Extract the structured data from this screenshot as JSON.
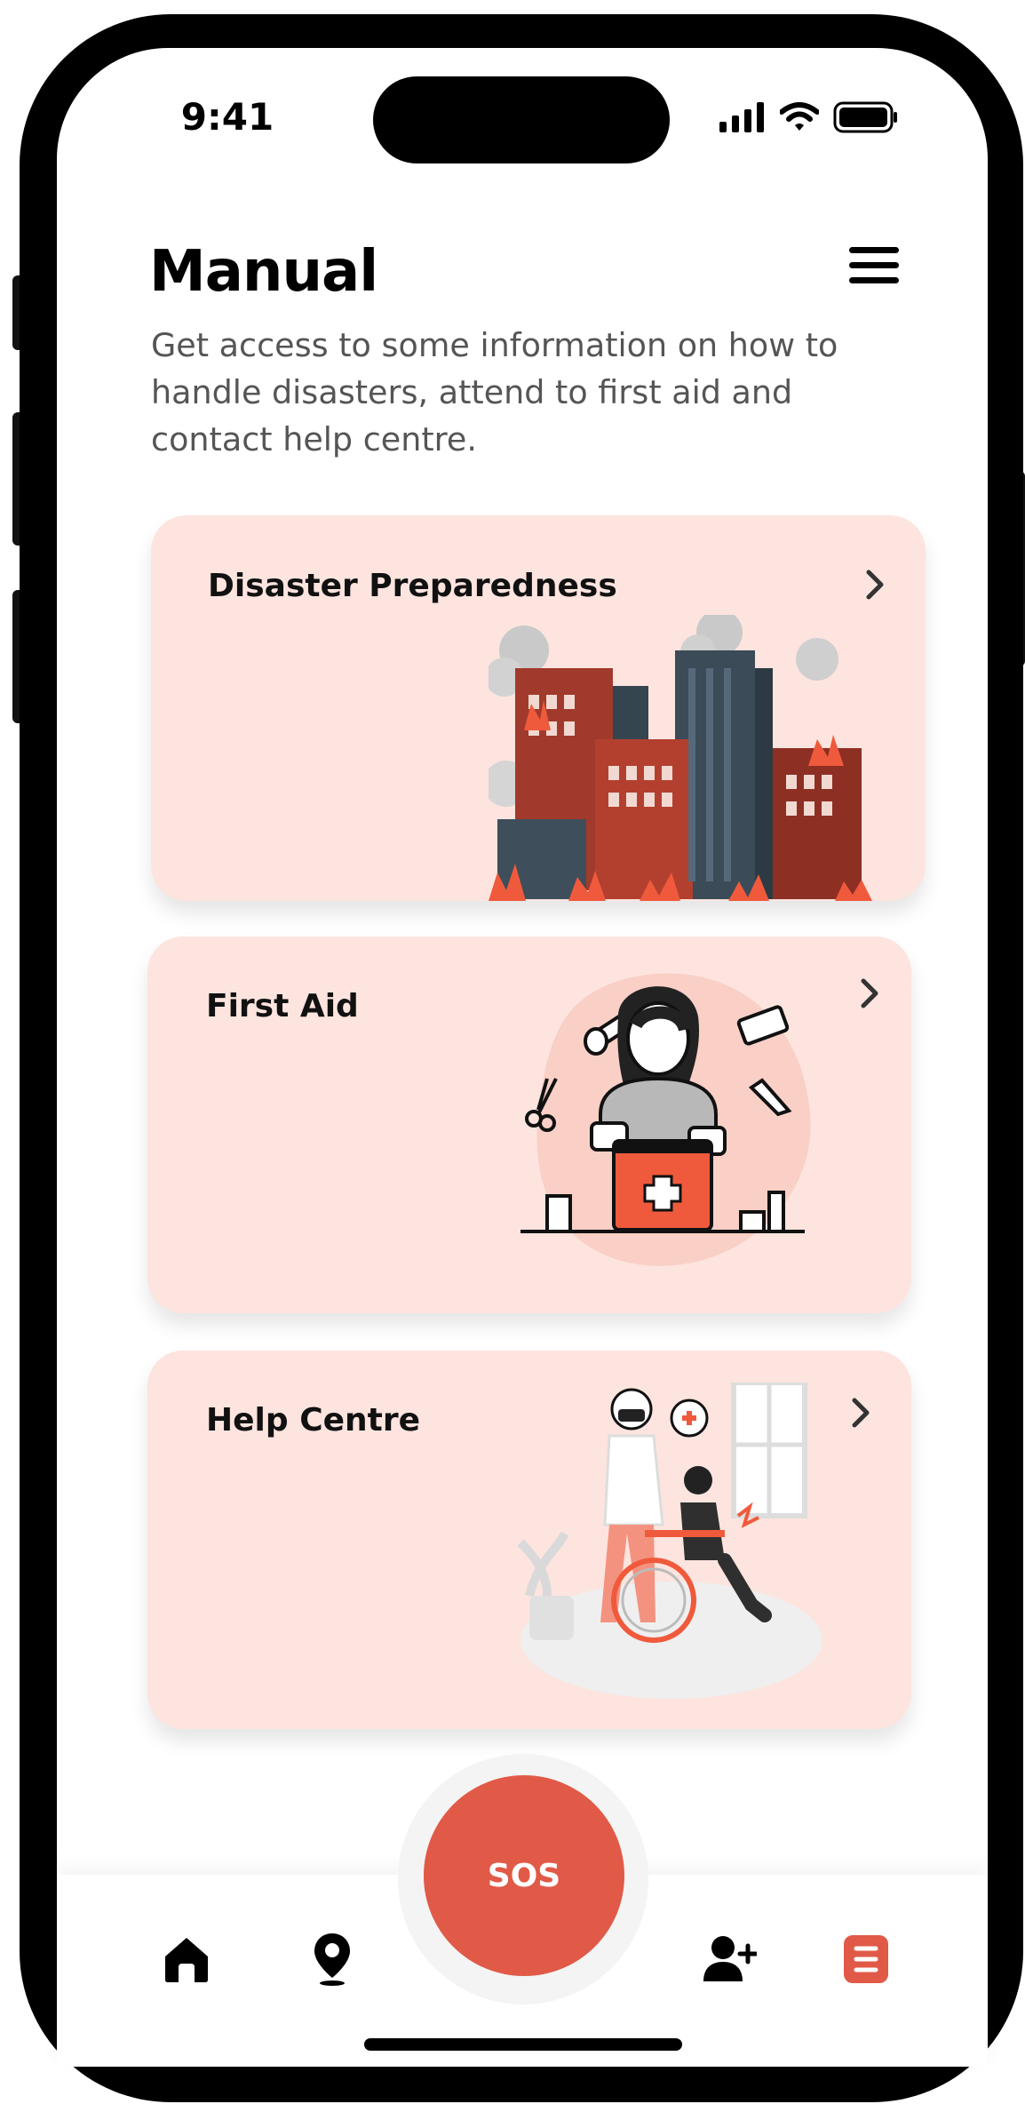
{
  "status_bar": {
    "time": "9:41"
  },
  "header": {
    "title": "Manual",
    "subtitle": "Get access to some information on how to handle disasters, attend to first aid and contact help centre."
  },
  "cards": [
    {
      "label": "Disaster Preparedness",
      "icon": "chevron-right-icon",
      "illustration": "burning-buildings-illustration"
    },
    {
      "label": "First Aid",
      "icon": "chevron-right-icon",
      "illustration": "first-aid-kit-illustration"
    },
    {
      "label": "Help Centre",
      "icon": "chevron-right-icon",
      "illustration": "wheelchair-doctor-illustration"
    }
  ],
  "bottom_nav": {
    "sos_label": "SOS",
    "items": [
      {
        "icon": "home-icon"
      },
      {
        "icon": "location-pin-icon"
      },
      {
        "icon": "add-contact-icon"
      },
      {
        "icon": "manual-icon",
        "active": true
      }
    ]
  },
  "colors": {
    "accent": "#e05a47",
    "card_bg": "#fde4df",
    "text_dark": "#111111",
    "text_muted": "#555555"
  }
}
